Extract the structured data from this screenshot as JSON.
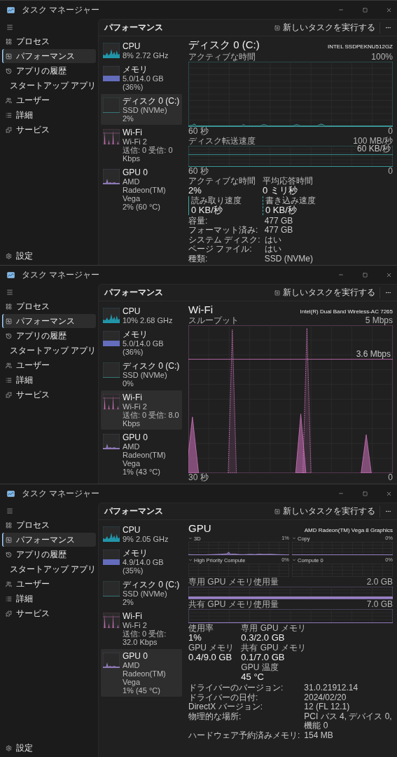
{
  "windows": [
    {
      "title": "タスク マネージャー",
      "nav": [
        {
          "label": "プロセス",
          "selected": false
        },
        {
          "label": "パフォーマンス",
          "selected": true
        },
        {
          "label": "アプリの履歴",
          "selected": false
        },
        {
          "label": "スタートアップ アプリ",
          "selected": false
        },
        {
          "label": "ユーザー",
          "selected": false
        },
        {
          "label": "詳細",
          "selected": false
        },
        {
          "label": "サービス",
          "selected": false
        }
      ],
      "settings": "設定",
      "header": {
        "title": "パフォーマンス",
        "action": "新しいタスクを実行する"
      },
      "devices": [
        {
          "kind": "cpu",
          "name": "CPU",
          "lines": [
            "8% 2.72 GHz"
          ],
          "selected": false
        },
        {
          "kind": "memory",
          "name": "メモリ",
          "lines": [
            "5.0/14.0 GB (36%)"
          ],
          "selected": false
        },
        {
          "kind": "disk",
          "name": "ディスク 0 (C:)",
          "lines": [
            "SSD (NVMe)",
            "2%"
          ],
          "selected": true
        },
        {
          "kind": "wifi",
          "name": "Wi-Fi",
          "lines": [
            "Wi-Fi 2",
            "送信: 0 受信: 0 Kbps"
          ],
          "selected": false
        },
        {
          "kind": "gpu",
          "name": "GPU 0",
          "lines": [
            "AMD Radeon(TM) Vega",
            "2% (60 °C)"
          ],
          "selected": false
        }
      ],
      "detail": {
        "title": "ディスク 0 (C:)",
        "model": "INTEL SSDPEKNU512GZ",
        "sections": [
          {
            "kind": "activity-graph",
            "label": "アクティブな時間",
            "scale": "100%",
            "time": "60 秒",
            "zero": "0"
          },
          {
            "kind": "transfer-graph",
            "label": "ディスク転送速度",
            "scale": "100 MB/秒",
            "marker": "60 KB/秒",
            "time": "60 秒",
            "zero": "0"
          },
          {
            "kind": "stats",
            "columns": [
              [
                {
                  "kind": "plain",
                  "label": "アクティブな時間",
                  "value": "2%"
                },
                {
                  "kind": "read",
                  "label": "読み取り速度",
                  "value": "0 KB/秒"
                }
              ],
              [
                {
                  "kind": "plain",
                  "label": "平均応答時間",
                  "value": "0 ミリ秒"
                },
                {
                  "kind": "write",
                  "label": "書き込み速度",
                  "value": "0 KB/秒"
                }
              ]
            ],
            "properties": [
              {
                "label": "容量:",
                "value": "477 GB"
              },
              {
                "label": "フォーマット済み:",
                "value": "477 GB"
              },
              {
                "label": "システム ディスク:",
                "value": "はい"
              },
              {
                "label": "ページ ファイル:",
                "value": "はい"
              },
              {
                "label": "種類:",
                "value": "SSD (NVMe)"
              }
            ]
          }
        ]
      }
    },
    {
      "title": "タスク マネージャー",
      "nav": [
        {
          "label": "プロセス",
          "selected": false
        },
        {
          "label": "パフォーマンス",
          "selected": true
        },
        {
          "label": "アプリの履歴",
          "selected": false
        },
        {
          "label": "スタートアップ アプリ",
          "selected": false
        },
        {
          "label": "ユーザー",
          "selected": false
        },
        {
          "label": "詳細",
          "selected": false
        },
        {
          "label": "サービス",
          "selected": false
        }
      ],
      "header": {
        "title": "パフォーマンス",
        "action": "新しいタスクを実行する"
      },
      "devices": [
        {
          "kind": "cpu",
          "name": "CPU",
          "lines": [
            "10% 2.68 GHz"
          ],
          "selected": false
        },
        {
          "kind": "memory",
          "name": "メモリ",
          "lines": [
            "5.0/14.0 GB (36%)"
          ],
          "selected": false
        },
        {
          "kind": "disk",
          "name": "ディスク 0 (C:)",
          "lines": [
            "SSD (NVMe)",
            "0%"
          ],
          "selected": false
        },
        {
          "kind": "wifi",
          "name": "Wi-Fi",
          "lines": [
            "Wi-Fi 2",
            "送信: 0 受信: 8.0 Kbps"
          ],
          "selected": true
        },
        {
          "kind": "gpu",
          "name": "GPU 0",
          "lines": [
            "AMD Radeon(TM) Vega",
            "1% (43 °C)"
          ],
          "selected": false
        }
      ],
      "detail": {
        "title": "Wi-Fi",
        "model": "Intel(R) Dual Band Wireless-AC 7265",
        "sections": [
          {
            "kind": "throughput-graph",
            "label": "スループット",
            "scale": "5 Mbps",
            "marker": "3.6 Mbps",
            "time": "30 秒",
            "zero": "0"
          }
        ]
      }
    },
    {
      "title": "タスク マネージャー",
      "nav": [
        {
          "label": "プロセス",
          "selected": false
        },
        {
          "label": "パフォーマンス",
          "selected": true
        },
        {
          "label": "アプリの履歴",
          "selected": false
        },
        {
          "label": "スタートアップ アプリ",
          "selected": false
        },
        {
          "label": "ユーザー",
          "selected": false
        },
        {
          "label": "詳細",
          "selected": false
        },
        {
          "label": "サービス",
          "selected": false
        }
      ],
      "settings": "設定",
      "header": {
        "title": "パフォーマンス",
        "action": "新しいタスクを実行する"
      },
      "devices": [
        {
          "kind": "cpu",
          "name": "CPU",
          "lines": [
            "9% 2.05 GHz"
          ],
          "selected": false
        },
        {
          "kind": "memory",
          "name": "メモリ",
          "lines": [
            "4.9/14.0 GB (35%)"
          ],
          "selected": false
        },
        {
          "kind": "disk",
          "name": "ディスク 0 (C:)",
          "lines": [
            "SSD (NVMe)",
            "2%"
          ],
          "selected": false
        },
        {
          "kind": "wifi",
          "name": "Wi-Fi",
          "lines": [
            "Wi-Fi 2",
            "送信: 0 受信: 32.0 Kbps"
          ],
          "selected": false
        },
        {
          "kind": "gpu",
          "name": "GPU 0",
          "lines": [
            "AMD Radeon(TM) Vega",
            "1% (45 °C)"
          ],
          "selected": true
        }
      ],
      "detail": {
        "title": "GPU",
        "model": "AMD Radeon(TM) Vega 8 Graphics",
        "sections": [
          {
            "kind": "engines",
            "items": [
              {
                "kind": "busy",
                "name": "3D",
                "value": "1%"
              },
              {
                "kind": "flat",
                "name": "Copy",
                "value": "0%"
              },
              {
                "kind": "idle",
                "name": "High Priority Compute",
                "value": "0%"
              },
              {
                "kind": "idle",
                "name": "Compute 0",
                "value": "0%"
              }
            ]
          },
          {
            "kind": "dedicated-graph",
            "label": "専用 GPU メモリ使用量",
            "scale": "2.0 GB"
          },
          {
            "kind": "shared-graph",
            "label": "共有 GPU メモリ使用量",
            "scale": "7.0 GB"
          },
          {
            "kind": "stats",
            "columns": [
              [
                {
                  "kind": "plain",
                  "label": "使用率",
                  "value": "1%"
                },
                {
                  "kind": "plain",
                  "label": "GPU メモリ",
                  "value": "0.4/9.0 GB"
                }
              ],
              [
                {
                  "kind": "plain",
                  "label": "専用 GPU メモリ",
                  "value": "0.3/2.0 GB"
                },
                {
                  "kind": "plain",
                  "label": "共有 GPU メモリ",
                  "value": "0.1/7.0 GB"
                },
                {
                  "kind": "plain",
                  "label": "GPU 温度",
                  "value": "45 °C"
                }
              ]
            ],
            "properties": [
              {
                "label": "ドライバーのバージョン:",
                "value": "31.0.21912.14"
              },
              {
                "label": "ドライバーの日付:",
                "value": "2024/02/20"
              },
              {
                "label": "DirectX バージョン:",
                "value": "12 (FL 12.1)"
              },
              {
                "label": "物理的な場所:",
                "value": "PCI バス 4, デバイス 0, 機能 0"
              },
              {
                "label": "ハードウェア予約済みメモリ:",
                "value": "154 MB"
              }
            ]
          }
        ]
      }
    }
  ]
}
